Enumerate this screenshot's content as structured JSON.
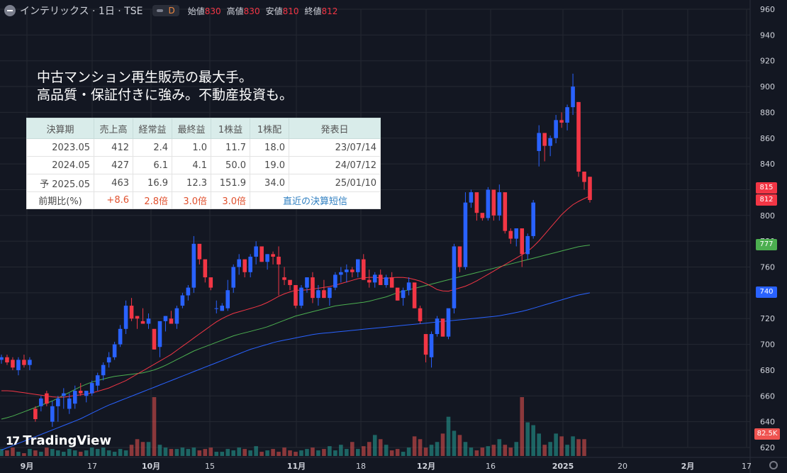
{
  "header": {
    "title": "インテリックス · 1日 · TSE",
    "interval_badge": "D",
    "ohlc": [
      {
        "label": "始値",
        "value": "830"
      },
      {
        "label": "高値",
        "value": "830"
      },
      {
        "label": "安値",
        "value": "810"
      },
      {
        "label": "終値",
        "value": "812"
      }
    ]
  },
  "description": {
    "line1": "中古マンション再生販売の最大手。",
    "line2": "高品質・保証付きに強み。不動産投資も。"
  },
  "financials": {
    "headers": [
      "決算期",
      "売上高",
      "経常益",
      "最終益",
      "1株益",
      "1株配",
      "発表日"
    ],
    "rows": [
      {
        "period": "2023.05",
        "sales": "412",
        "ordinary": "2.4",
        "net": "1.0",
        "eps": "11.7",
        "dps": "18.0",
        "date": "23/07/14"
      },
      {
        "period": "2024.05",
        "sales": "427",
        "ordinary": "6.1",
        "net": "4.1",
        "eps": "50.0",
        "dps": "19.0",
        "date": "24/07/12"
      },
      {
        "period": "予 2025.05",
        "sales": "463",
        "ordinary": "16.9",
        "net": "12.3",
        "eps": "151.9",
        "dps": "34.0",
        "date": "25/01/10"
      }
    ],
    "change": {
      "label": "前期比(%)",
      "sales": "+8.6",
      "ordinary": "2.8倍",
      "net": "3.0倍",
      "eps": "3.0倍",
      "link": "直近の決算短信"
    }
  },
  "watermark": "TradingView",
  "colors": {
    "up": "#2962ff",
    "down": "#f23645",
    "ma_short": "#f23645",
    "ma_mid": "#4caf50",
    "ma_long": "#2962ff",
    "vol_up": "#26a69a",
    "vol_down": "#ef5350"
  },
  "price_tags": {
    "last_close": "815",
    "close": "812",
    "ma_mid": "777",
    "ma_long": "740",
    "volume": "82.5K"
  },
  "chart_data": {
    "type": "candlestick",
    "title": "インテリックス · 1日 · TSE",
    "y_axis": {
      "ticks": [
        960,
        940,
        920,
        900,
        880,
        860,
        840,
        820,
        800,
        780,
        760,
        740,
        720,
        700,
        680,
        660,
        640,
        620
      ],
      "ylim": [
        620,
        960
      ]
    },
    "x_axis": {
      "ticks": [
        "9月",
        "17",
        "10月",
        "15",
        "11月",
        "18",
        "12月",
        "16",
        "2025",
        "20",
        "2月",
        "17"
      ]
    },
    "candles": [
      [
        688,
        692,
        685,
        690
      ],
      [
        690,
        692,
        684,
        686
      ],
      [
        688,
        690,
        680,
        682
      ],
      [
        680,
        690,
        676,
        688
      ],
      [
        688,
        692,
        682,
        684
      ],
      [
        684,
        690,
        680,
        688
      ],
      [
        650,
        652,
        640,
        642
      ],
      [
        652,
        660,
        648,
        658
      ],
      [
        662,
        664,
        652,
        654
      ],
      [
        640,
        656,
        636,
        652
      ],
      [
        652,
        660,
        640,
        658
      ],
      [
        660,
        666,
        650,
        662
      ],
      [
        650,
        662,
        646,
        658
      ],
      [
        654,
        668,
        650,
        664
      ],
      [
        664,
        670,
        660,
        662
      ],
      [
        660,
        664,
        655,
        664
      ],
      [
        662,
        672,
        660,
        670
      ],
      [
        668,
        678,
        664,
        676
      ],
      [
        676,
        686,
        672,
        684
      ],
      [
        686,
        694,
        682,
        690
      ],
      [
        690,
        702,
        688,
        700
      ],
      [
        700,
        715,
        698,
        712
      ],
      [
        712,
        734,
        708,
        730
      ],
      [
        730,
        736,
        718,
        720
      ],
      [
        722,
        722,
        712,
        720
      ],
      [
        718,
        728,
        716,
        716
      ],
      [
        716,
        724,
        712,
        720
      ],
      [
        712,
        700,
        696,
        696
      ],
      [
        698,
        700,
        690,
        718
      ],
      [
        718,
        722,
        710,
        722
      ],
      [
        720,
        726,
        716,
        716
      ],
      [
        716,
        730,
        712,
        728
      ],
      [
        730,
        740,
        728,
        738
      ],
      [
        738,
        746,
        734,
        744
      ],
      [
        744,
        784,
        740,
        778
      ],
      [
        778,
        776,
        762,
        766
      ],
      [
        766,
        760,
        748,
        752
      ],
      [
        752,
        750,
        742,
        744
      ],
      [
        728,
        734,
        724,
        728
      ],
      [
        726,
        732,
        726,
        730
      ],
      [
        728,
        750,
        726,
        742
      ],
      [
        744,
        762,
        740,
        760
      ],
      [
        760,
        770,
        754,
        766
      ],
      [
        766,
        760,
        752,
        756
      ],
      [
        756,
        770,
        752,
        768
      ],
      [
        768,
        780,
        762,
        776
      ],
      [
        776,
        772,
        764,
        764
      ],
      [
        764,
        770,
        758,
        770
      ],
      [
        770,
        772,
        762,
        768
      ],
      [
        768,
        776,
        738,
        762
      ],
      [
        752,
        760,
        746,
        750
      ],
      [
        750,
        748,
        742,
        746
      ],
      [
        746,
        732,
        728,
        730
      ],
      [
        730,
        746,
        728,
        744
      ],
      [
        744,
        752,
        740,
        752
      ],
      [
        752,
        756,
        732,
        736
      ],
      [
        736,
        746,
        730,
        742
      ],
      [
        742,
        750,
        736,
        736
      ],
      [
        736,
        744,
        730,
        744
      ],
      [
        744,
        756,
        742,
        754
      ],
      [
        754,
        760,
        748,
        756
      ],
      [
        756,
        762,
        748,
        758
      ],
      [
        758,
        760,
        752,
        756
      ],
      [
        756,
        766,
        752,
        766
      ],
      [
        766,
        770,
        750,
        750
      ],
      [
        750,
        758,
        744,
        748
      ],
      [
        748,
        756,
        744,
        754
      ],
      [
        754,
        758,
        746,
        746
      ],
      [
        746,
        754,
        744,
        752
      ],
      [
        752,
        756,
        744,
        744
      ],
      [
        744,
        740,
        734,
        734
      ],
      [
        736,
        744,
        730,
        742
      ],
      [
        742,
        752,
        738,
        748
      ],
      [
        748,
        740,
        728,
        728
      ],
      [
        728,
        730,
        716,
        718
      ],
      [
        708,
        702,
        686,
        692
      ],
      [
        690,
        710,
        682,
        708
      ],
      [
        708,
        722,
        706,
        720
      ],
      [
        720,
        714,
        706,
        706
      ],
      [
        706,
        726,
        704,
        728
      ],
      [
        728,
        778,
        724,
        776
      ],
      [
        776,
        770,
        756,
        760
      ],
      [
        760,
        818,
        758,
        810
      ],
      [
        810,
        820,
        806,
        818
      ],
      [
        818,
        804,
        796,
        802
      ],
      [
        802,
        800,
        796,
        798
      ],
      [
        798,
        822,
        796,
        820
      ],
      [
        820,
        800,
        796,
        800
      ],
      [
        800,
        824,
        796,
        818
      ],
      [
        818,
        800,
        786,
        788
      ],
      [
        788,
        790,
        778,
        782
      ],
      [
        782,
        790,
        776,
        790
      ],
      [
        790,
        776,
        760,
        770
      ],
      [
        770,
        786,
        766,
        784
      ],
      [
        784,
        812,
        782,
        810
      ],
      [
        850,
        870,
        838,
        864
      ],
      [
        864,
        854,
        842,
        854
      ],
      [
        854,
        862,
        846,
        860
      ],
      [
        860,
        878,
        856,
        874
      ],
      [
        874,
        880,
        868,
        872
      ],
      [
        872,
        886,
        866,
        884
      ],
      [
        884,
        910,
        878,
        900
      ],
      [
        888,
        888,
        830,
        834
      ],
      [
        834,
        830,
        820,
        826
      ],
      [
        830,
        830,
        810,
        812
      ]
    ],
    "ma_short": [
      664,
      664,
      663,
      662,
      661,
      660,
      659,
      659,
      660,
      661,
      662,
      664,
      666,
      669,
      672,
      676,
      680,
      684,
      688,
      692,
      697,
      702,
      707,
      712,
      717,
      721,
      724,
      726,
      728,
      730,
      733,
      737,
      740,
      742,
      742,
      743,
      744,
      745,
      747,
      749,
      751,
      752,
      752,
      751,
      752,
      752,
      751,
      749,
      746,
      742,
      741,
      743,
      745,
      748,
      752,
      756,
      760,
      764,
      768,
      772,
      778,
      786,
      794,
      802,
      808,
      812,
      815
    ],
    "ma_mid": [
      642,
      644,
      647,
      650,
      653,
      656,
      660,
      664,
      668,
      671,
      673,
      675,
      676,
      677,
      678,
      680,
      683,
      687,
      691,
      695,
      698,
      701,
      704,
      707,
      709,
      711,
      713,
      716,
      719,
      722,
      724,
      726,
      728,
      730,
      731,
      732,
      733,
      735,
      737,
      740,
      742,
      744,
      746,
      748,
      750,
      752,
      754,
      756,
      758,
      760,
      762,
      764,
      766,
      768,
      770,
      772,
      774,
      776,
      777
    ],
    "ma_long": [
      618,
      622,
      626,
      630,
      634,
      638,
      642,
      647,
      652,
      656,
      660,
      664,
      668,
      672,
      676,
      680,
      684,
      688,
      692,
      696,
      699,
      702,
      704,
      706,
      708,
      709,
      710,
      711,
      712,
      713,
      714,
      715,
      716,
      717,
      718,
      719,
      720,
      721,
      722,
      724,
      726,
      729,
      732,
      735,
      738,
      740
    ],
    "volume_levels": [
      0.05,
      0.04,
      0.06,
      0.03,
      0.02,
      0.05,
      0.04,
      0.03,
      0.06,
      0.05,
      0.04,
      0.03,
      0.05,
      0.04,
      0.03,
      0.04,
      0.06,
      0.05,
      0.06,
      0.04,
      0.03,
      0.05,
      0.04,
      0.08,
      0.12,
      0.1,
      0.1,
      0.42,
      0.08,
      0.06,
      0.05,
      0.05,
      0.06,
      0.05,
      0.06,
      0.04,
      0.05,
      0.06,
      0.03,
      0.03,
      0.05,
      0.04,
      0.06,
      0.05,
      0.04,
      0.07,
      0.03,
      0.04,
      0.05,
      0.03,
      0.06,
      0.04,
      0.03,
      0.04,
      0.05,
      0.06,
      0.04,
      0.05,
      0.07,
      0.04,
      0.08,
      0.05,
      0.1,
      0.05,
      0.07,
      0.1,
      0.15,
      0.12,
      0.08,
      0.04,
      0.05,
      0.03,
      0.06,
      0.14,
      0.12,
      0.06,
      0.08,
      0.1,
      0.16,
      0.28,
      0.18,
      0.15,
      0.1,
      0.06,
      0.04,
      0.06,
      0.07,
      0.08,
      0.12,
      0.08,
      0.06,
      0.1,
      0.42,
      0.24,
      0.22,
      0.16,
      0.08,
      0.1,
      0.16,
      0.14,
      0.08,
      0.14,
      0.12,
      0.12
    ]
  }
}
